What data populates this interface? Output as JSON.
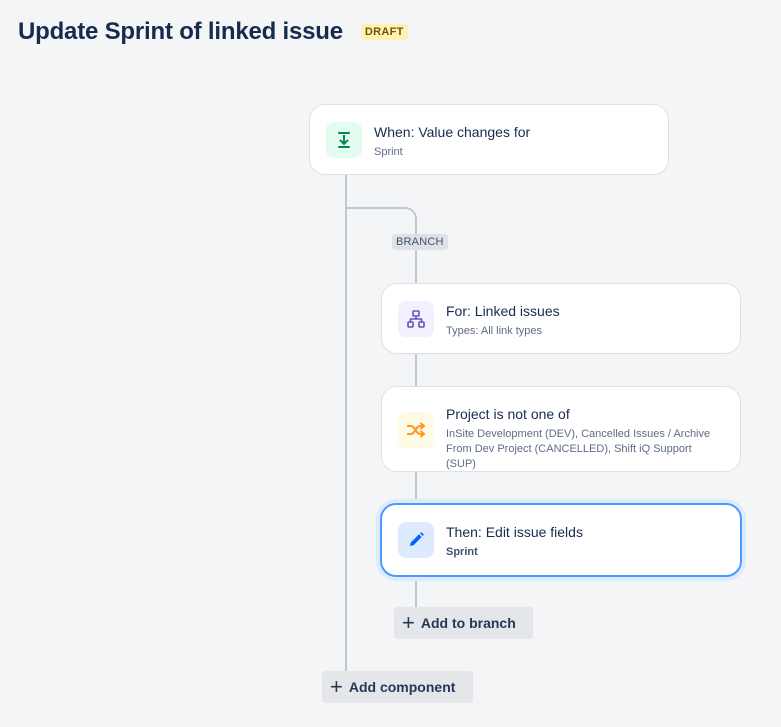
{
  "header": {
    "title": "Update Sprint of linked issue",
    "status_badge": "DRAFT"
  },
  "flow": {
    "trigger": {
      "title": "When: Value changes for",
      "subtitle": "Sprint",
      "icon": "trigger-download-icon",
      "icon_color": "#00875a",
      "icon_bg": "#e3fcef"
    },
    "branch_label": "BRANCH",
    "branch_rule": {
      "title": "For: Linked issues",
      "subtitle": "Types: All link types",
      "icon": "hierarchy-icon",
      "icon_color": "#6554c0",
      "icon_bg": "#f3f0ff"
    },
    "condition": {
      "title": "Project is not one of",
      "subtitle_line1": "InSite Development (DEV), Cancelled Issues / Archive",
      "subtitle_line2": "From Dev Project (CANCELLED), Shift iQ Support (SUP)",
      "icon": "shuffle-icon",
      "icon_color": "#ff991f",
      "icon_bg": "#fffae6"
    },
    "action": {
      "title": "Then: Edit issue fields",
      "subtitle": "Sprint",
      "icon": "pencil-icon",
      "icon_color": "#0065ff",
      "icon_bg": "#deebff",
      "selected": true
    },
    "add_to_branch_label": "Add to branch",
    "add_component_label": "Add component"
  }
}
